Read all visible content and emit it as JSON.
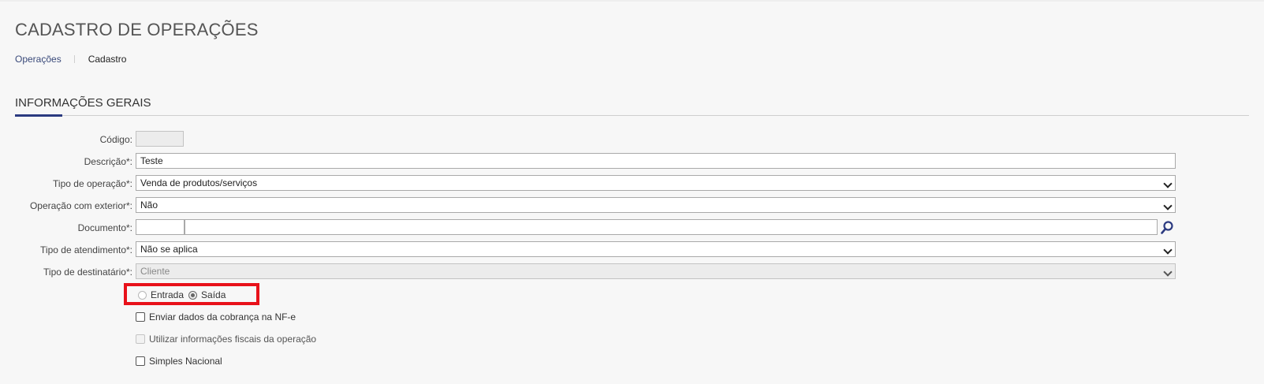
{
  "header": {
    "title": "CADASTRO DE OPERAÇÕES",
    "breadcrumb": {
      "parent": "Operações",
      "current": "Cadastro"
    }
  },
  "section": {
    "title": "INFORMAÇÕES GERAIS"
  },
  "form": {
    "codigo": {
      "label": "Código:",
      "value": ""
    },
    "descricao": {
      "label": "Descrição*:",
      "value": "Teste"
    },
    "tipo_operacao": {
      "label": "Tipo de operação*:",
      "value": "Venda de produtos/serviços"
    },
    "operacao_exterior": {
      "label": "Operação com exterior*:",
      "value": "Não"
    },
    "documento": {
      "label": "Documento*:",
      "code": "",
      "description": ""
    },
    "tipo_atendimento": {
      "label": "Tipo de atendimento*:",
      "value": "Não se aplica"
    },
    "tipo_destinatario": {
      "label": "Tipo de destinatário*:",
      "value": "Cliente"
    },
    "direcao": {
      "options": [
        {
          "label": "Entrada",
          "checked": false
        },
        {
          "label": "Saída",
          "checked": true
        }
      ]
    },
    "checkboxes": [
      {
        "label": "Enviar dados da cobrança na NF-e",
        "checked": false,
        "disabled": false
      },
      {
        "label": "Utilizar informações fiscais da operação",
        "checked": false,
        "disabled": true
      },
      {
        "label": "Simples Nacional",
        "checked": false,
        "disabled": false
      }
    ]
  },
  "icons": {
    "search": "search-icon",
    "dropdown": "chevron-down-icon"
  },
  "colors": {
    "accent": "#2b3a80",
    "highlight": "#e8111a",
    "link": "#3a4a7a"
  }
}
